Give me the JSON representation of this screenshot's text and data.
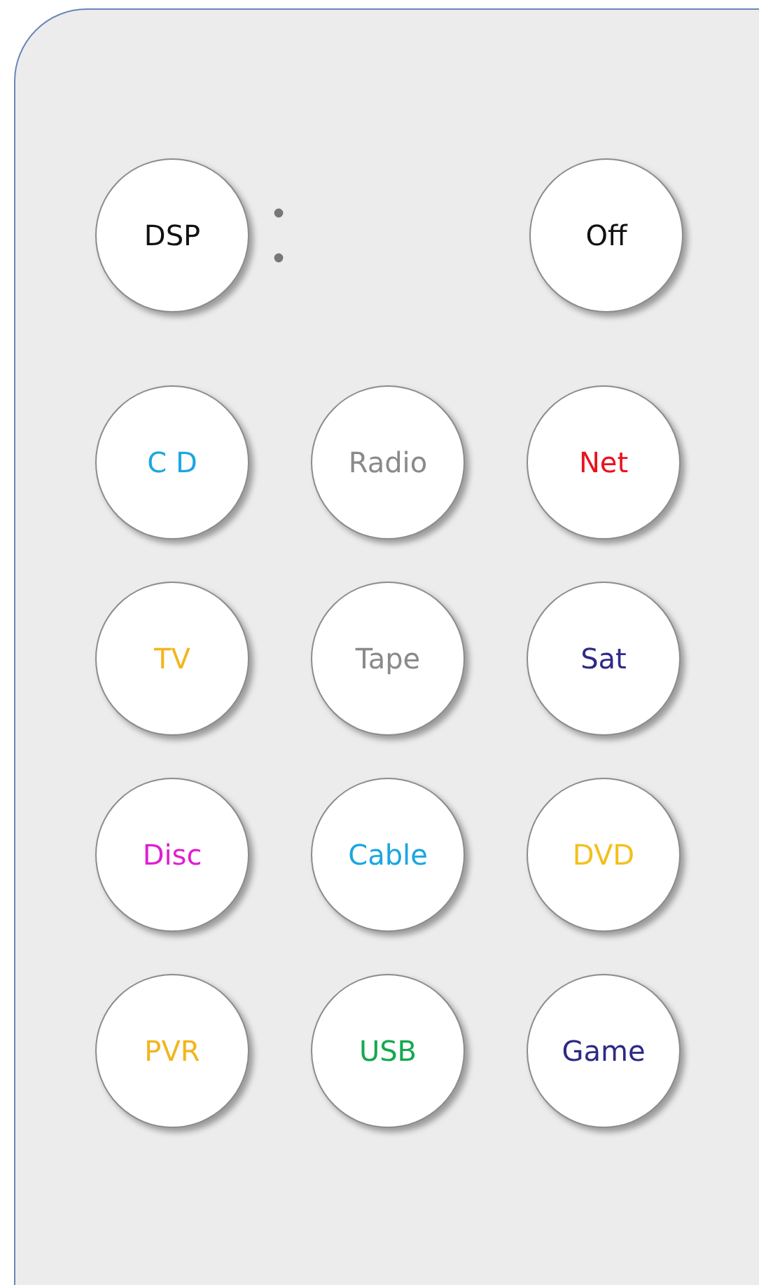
{
  "top_buttons": [
    {
      "label": "DSP"
    },
    {
      "label": "Off"
    }
  ],
  "source_buttons": [
    {
      "label": "C D",
      "color": "#1aa7e0"
    },
    {
      "label": "Radio",
      "color": "#8a8a8a"
    },
    {
      "label": "Net",
      "color": "#e8141e"
    },
    {
      "label": "TV",
      "color": "#f2b51c"
    },
    {
      "label": "Tape",
      "color": "#8a8a8a"
    },
    {
      "label": "Sat",
      "color": "#2e2a86"
    },
    {
      "label": "Disc",
      "color": "#e01ed0"
    },
    {
      "label": "Cable",
      "color": "#1aa7e0"
    },
    {
      "label": "DVD",
      "color": "#f2c01c"
    },
    {
      "label": "PVR",
      "color": "#f2b51c"
    },
    {
      "label": "USB",
      "color": "#14a850"
    },
    {
      "label": "Game",
      "color": "#2e2a86"
    }
  ]
}
